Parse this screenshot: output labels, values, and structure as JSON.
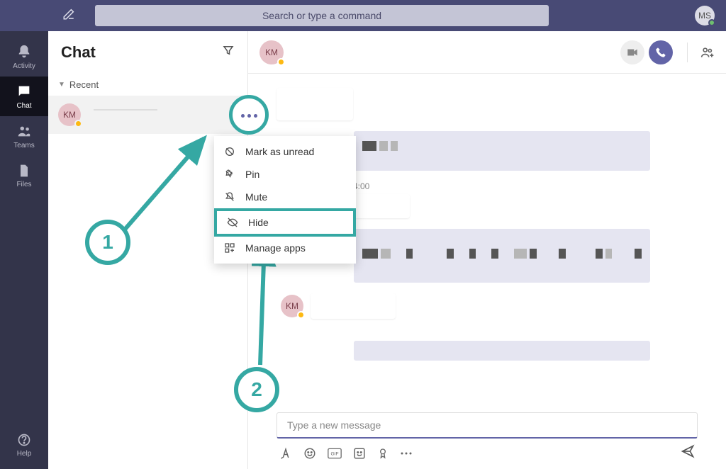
{
  "topbar": {
    "search_placeholder": "Search or type a command",
    "user_initials": "MS"
  },
  "rail": {
    "activity": "Activity",
    "chat": "Chat",
    "teams": "Teams",
    "files": "Files",
    "help": "Help"
  },
  "list": {
    "title": "Chat",
    "recent_label": "Recent",
    "items": [
      {
        "initials": "KM"
      }
    ]
  },
  "context_menu": {
    "mark_unread": "Mark as unread",
    "pin": "Pin",
    "mute": "Mute",
    "hide": "Hide",
    "manage_apps": "Manage apps"
  },
  "chat": {
    "peer_initials": "KM",
    "timestamp": "4:00"
  },
  "composer": {
    "placeholder": "Type a new message"
  },
  "callouts": {
    "one": "1",
    "two": "2"
  }
}
